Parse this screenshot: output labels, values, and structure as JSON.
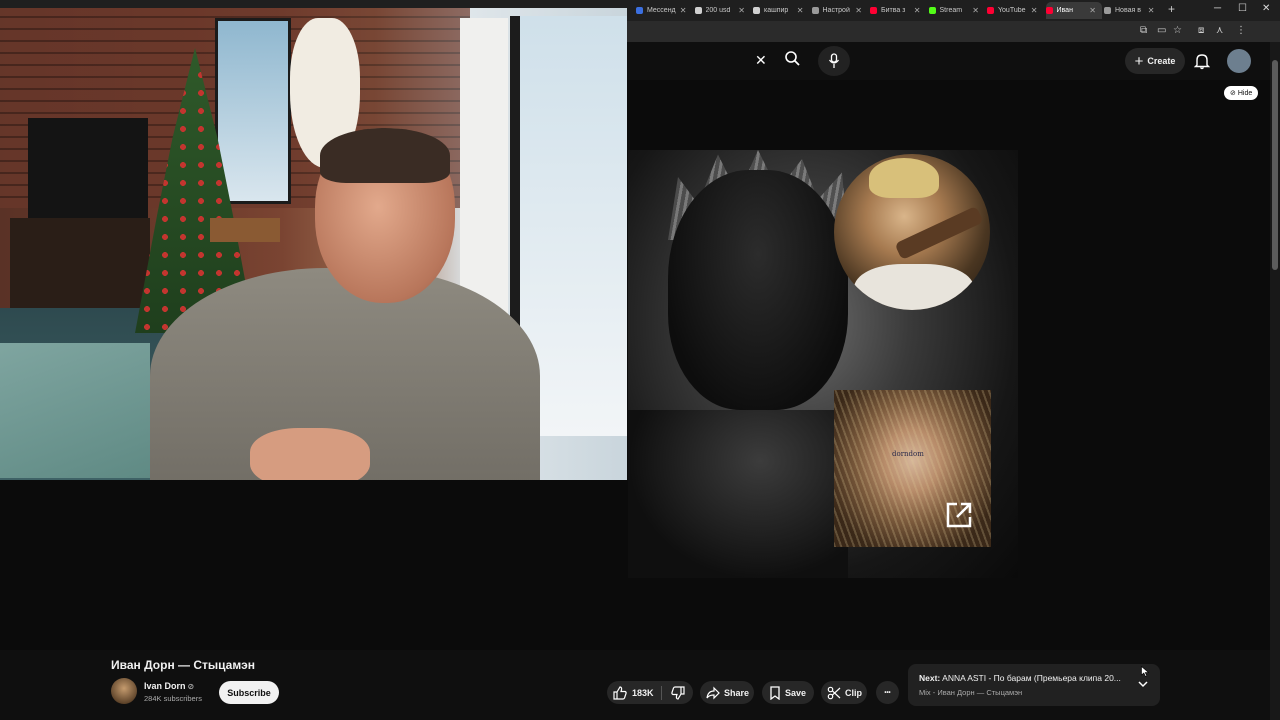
{
  "browser": {
    "tabs": [
      {
        "label": "Мессенд",
        "color": "#3b6fe0"
      },
      {
        "label": "200 usd",
        "color": "#d0d0d0"
      },
      {
        "label": "кашпир",
        "color": "#d0d0d0"
      },
      {
        "label": "Настрой",
        "color": "#9a9a9a"
      },
      {
        "label": "Битва з",
        "color": "#ff0033"
      },
      {
        "label": "Stream",
        "color": "#53fc18"
      },
      {
        "label": "YouTube",
        "color": "#ff0033"
      },
      {
        "label": "Иван",
        "color": "#ff0033",
        "active": true
      },
      {
        "label": "Новая в",
        "color": "#9a9a9a"
      }
    ],
    "new_tab_label": "+"
  },
  "header": {
    "create_label": "Create",
    "hide_label": "Hide"
  },
  "video": {
    "tattoo_text": "dorndom"
  },
  "info": {
    "title": "Иван Дорн — Стыцамэн",
    "channel_name": "Ivan Dorn",
    "verified_glyph": "⊘",
    "subscribers": "284K subscribers",
    "subscribe_label": "Subscribe",
    "like_count": "183K",
    "share_label": "Share",
    "save_label": "Save",
    "clip_label": "Clip",
    "more_glyph": "•••"
  },
  "next_up": {
    "prefix": "Next:",
    "title": "ANNA ASTI - По барам (Премьера клипа 20...",
    "subtitle": "Mix - Иван Дорн — Стыцамэн"
  },
  "icons": {
    "clear": "close-icon",
    "search": "search-icon",
    "mic": "mic-icon",
    "bell": "bell-icon",
    "like": "thumb-up-icon",
    "dislike": "thumb-down-icon",
    "share": "share-arrow-icon",
    "save": "bookmark-icon",
    "clip": "scissors-icon",
    "external": "external-link-icon"
  },
  "colors": {
    "background": "#0f0f0f",
    "pill": "#272727",
    "youtube_red": "#ff0033"
  }
}
